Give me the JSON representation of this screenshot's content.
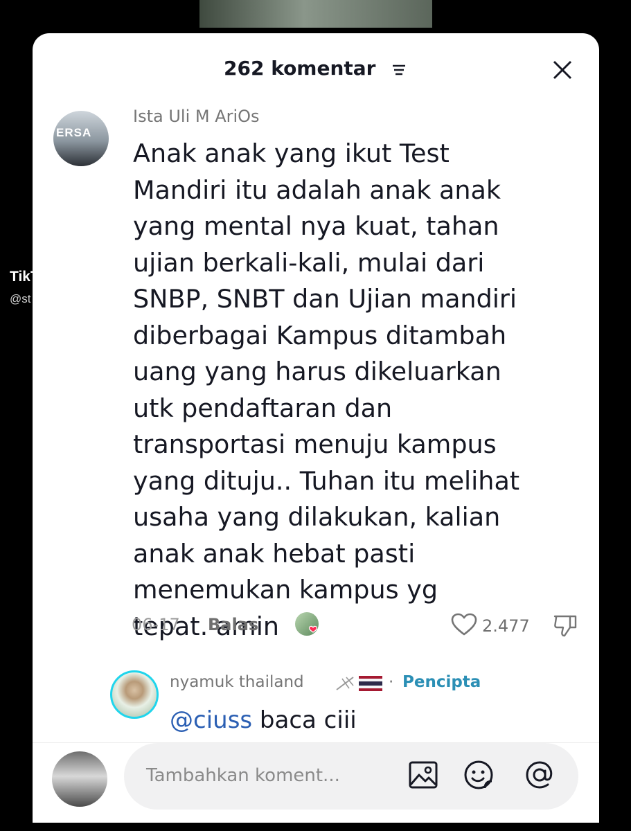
{
  "brand": {
    "logo_text": "TikTok",
    "handle_partial": "@st"
  },
  "header": {
    "comment_count": "262 komentar"
  },
  "comment": {
    "author": "Ista Uli M AriOs",
    "avatar_text": "ERSA",
    "text": "Anak anak yang ikut Test\nMandiri itu adalah anak anak\nyang mental nya kuat, tahan\nujian berkali-kali, mulai dari\nSNBP, SNBT dan Ujian mandiri\ndiberbagai Kampus ditambah\nuang yang harus dikeluarkan\nutk pendaftaran dan\ntransportasi menuju kampus\nyang dituju.. Tuhan itu melihat\nusaha yang dilakukan, kalian\nanak anak hebat pasti\nmenemukan kampus yg\ntepat. amin",
    "date": "06-17",
    "reply_label": "Balas",
    "like_count": "2.477"
  },
  "reply": {
    "author": "nyamuk thailand",
    "separator": "·",
    "badge": "Pencipta",
    "mention": "@ciuss",
    "text": " baca ciii"
  },
  "composer": {
    "placeholder": "Tambahkan koment..."
  },
  "colors": {
    "tiktok_cyan": "#25F4EE",
    "tiktok_red": "#FE2C55",
    "creator_badge": "#2B8FB5",
    "mention": "#2B5FB3"
  },
  "icons": {
    "filter": "filter-lines-icon",
    "close": "close-icon",
    "like": "heart-outline-icon",
    "dislike": "thumbs-down-icon",
    "image": "image-icon",
    "emoji": "emoji-icon",
    "mention": "at-icon"
  }
}
